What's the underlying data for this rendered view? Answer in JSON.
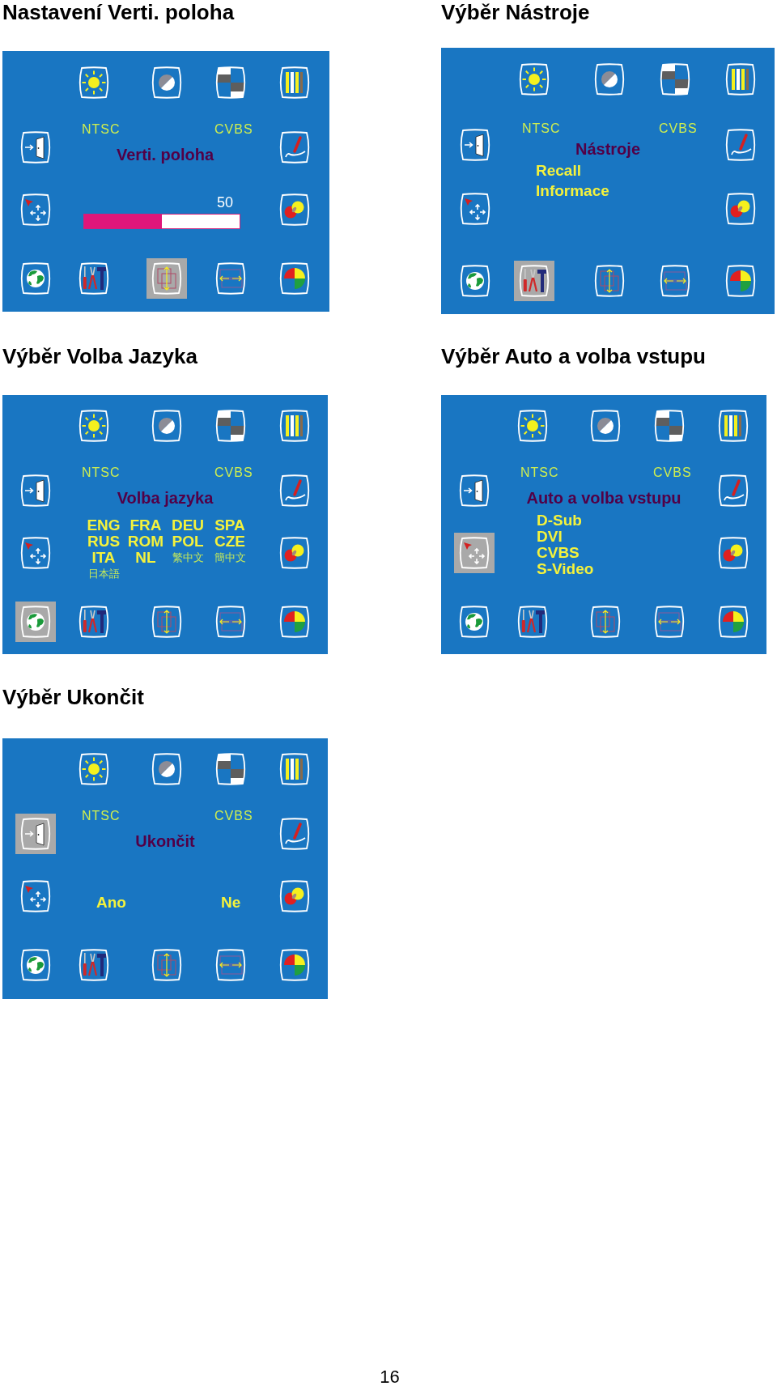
{
  "sections": [
    {
      "heading": "Nastavení Verti. poloha",
      "screen": {
        "icons_top": [
          {
            "kind": "sun",
            "selected": false
          },
          {
            "kind": "half_circle",
            "selected": false
          },
          {
            "kind": "checker",
            "selected": false
          },
          {
            "kind": "stripes",
            "selected": false
          }
        ],
        "icons_left": [
          {
            "kind": "door",
            "selected": false
          },
          {
            "kind": "move",
            "selected": false
          }
        ],
        "icons_right": [
          {
            "kind": "pen",
            "selected": false
          },
          {
            "kind": "circles",
            "selected": false
          }
        ],
        "icons_bottom": [
          {
            "kind": "globe",
            "selected": false
          },
          {
            "kind": "tools",
            "selected": false
          },
          {
            "kind": "vertical",
            "selected": true
          },
          {
            "kind": "horizontal",
            "selected": false
          },
          {
            "kind": "pie",
            "selected": false
          }
        ],
        "standard": "NTSC",
        "source": "CVBS",
        "menu_title": "Verti. poloha",
        "content": {
          "kind": "slider",
          "reading": "50",
          "level": 0.5
        }
      }
    },
    {
      "heading": "Výběr Nástroje",
      "screen": {
        "icons_top": [
          {
            "kind": "sun",
            "selected": false
          },
          {
            "kind": "half_circle",
            "selected": false
          },
          {
            "kind": "checker",
            "selected": false
          },
          {
            "kind": "stripes",
            "selected": false
          }
        ],
        "icons_left": [
          {
            "kind": "door",
            "selected": false
          },
          {
            "kind": "move",
            "selected": false
          }
        ],
        "icons_right": [
          {
            "kind": "pen",
            "selected": false
          },
          {
            "kind": "circles",
            "selected": false
          }
        ],
        "icons_bottom": [
          {
            "kind": "globe",
            "selected": false
          },
          {
            "kind": "tools",
            "selected": true
          },
          {
            "kind": "vertical",
            "selected": false
          },
          {
            "kind": "horizontal",
            "selected": false
          },
          {
            "kind": "pie",
            "selected": false
          }
        ],
        "standard": "NTSC",
        "source": "CVBS",
        "menu_title": "Nástroje",
        "content": {
          "kind": "menu",
          "items": [
            "Recall",
            "Informace"
          ]
        }
      }
    },
    {
      "heading": "Výběr Volba Jazyka",
      "screen": {
        "icons_top": [
          {
            "kind": "sun",
            "selected": false
          },
          {
            "kind": "half_circle",
            "selected": false
          },
          {
            "kind": "checker",
            "selected": false
          },
          {
            "kind": "stripes",
            "selected": false
          }
        ],
        "icons_left": [
          {
            "kind": "door",
            "selected": false
          },
          {
            "kind": "move",
            "selected": false
          }
        ],
        "icons_right": [
          {
            "kind": "pen",
            "selected": false
          },
          {
            "kind": "circles",
            "selected": false
          }
        ],
        "icons_bottom": [
          {
            "kind": "globe",
            "selected": true
          },
          {
            "kind": "tools",
            "selected": false
          },
          {
            "kind": "vertical",
            "selected": false
          },
          {
            "kind": "horizontal",
            "selected": false
          },
          {
            "kind": "pie",
            "selected": false
          }
        ],
        "standard": "NTSC",
        "source": "CVBS",
        "menu_title": "Volba jazyka",
        "content": {
          "kind": "languages",
          "rows": [
            [
              {
                "label": "ENG",
                "kind": "latin"
              },
              {
                "label": "FRA",
                "kind": "latin"
              },
              {
                "label": "DEU",
                "kind": "latin"
              },
              {
                "label": "SPA",
                "kind": "latin"
              }
            ],
            [
              {
                "label": "RUS",
                "kind": "latin"
              },
              {
                "label": "ROM",
                "kind": "latin"
              },
              {
                "label": "POL",
                "kind": "latin"
              },
              {
                "label": "CZE",
                "kind": "latin"
              }
            ],
            [
              {
                "label": "ITA",
                "kind": "latin"
              },
              {
                "label": "NL",
                "kind": "latin"
              },
              {
                "label": "繁中文",
                "kind": "cjk"
              },
              {
                "label": "簡中文",
                "kind": "cjk"
              }
            ],
            [
              {
                "label": "日本語",
                "kind": "cjk"
              }
            ]
          ]
        }
      }
    },
    {
      "heading": "Výběr Auto a volba vstupu",
      "screen": {
        "icons_top": [
          {
            "kind": "sun",
            "selected": false
          },
          {
            "kind": "half_circle",
            "selected": false
          },
          {
            "kind": "checker",
            "selected": false
          },
          {
            "kind": "stripes",
            "selected": false
          }
        ],
        "icons_left": [
          {
            "kind": "door",
            "selected": false
          },
          {
            "kind": "move",
            "selected": true
          }
        ],
        "icons_right": [
          {
            "kind": "pen",
            "selected": false
          },
          {
            "kind": "circles",
            "selected": false
          }
        ],
        "icons_bottom": [
          {
            "kind": "globe",
            "selected": false
          },
          {
            "kind": "tools",
            "selected": false
          },
          {
            "kind": "vertical",
            "selected": false
          },
          {
            "kind": "horizontal",
            "selected": false
          },
          {
            "kind": "pie",
            "selected": false
          }
        ],
        "standard": "NTSC",
        "source": "CVBS",
        "menu_title": "Auto a volba vstupu",
        "content": {
          "kind": "inputs",
          "items": [
            "D-Sub",
            "DVI",
            "CVBS",
            "S-Video"
          ]
        }
      }
    },
    {
      "heading": "Výběr Ukončit",
      "screen": {
        "icons_top": [
          {
            "kind": "sun",
            "selected": false
          },
          {
            "kind": "half_circle",
            "selected": false
          },
          {
            "kind": "checker",
            "selected": false
          },
          {
            "kind": "stripes",
            "selected": false
          }
        ],
        "icons_left": [
          {
            "kind": "door",
            "selected": true
          },
          {
            "kind": "move",
            "selected": false
          }
        ],
        "icons_right": [
          {
            "kind": "pen",
            "selected": false
          },
          {
            "kind": "circles",
            "selected": false
          }
        ],
        "icons_bottom": [
          {
            "kind": "globe",
            "selected": false
          },
          {
            "kind": "tools",
            "selected": false
          },
          {
            "kind": "vertical",
            "selected": false
          },
          {
            "kind": "horizontal",
            "selected": false
          },
          {
            "kind": "pie",
            "selected": false
          }
        ],
        "standard": "NTSC",
        "source": "CVBS",
        "menu_title": "Ukončit",
        "content": {
          "kind": "choices",
          "options": [
            "Ano",
            "Ne"
          ]
        }
      }
    }
  ],
  "page_number": "16"
}
